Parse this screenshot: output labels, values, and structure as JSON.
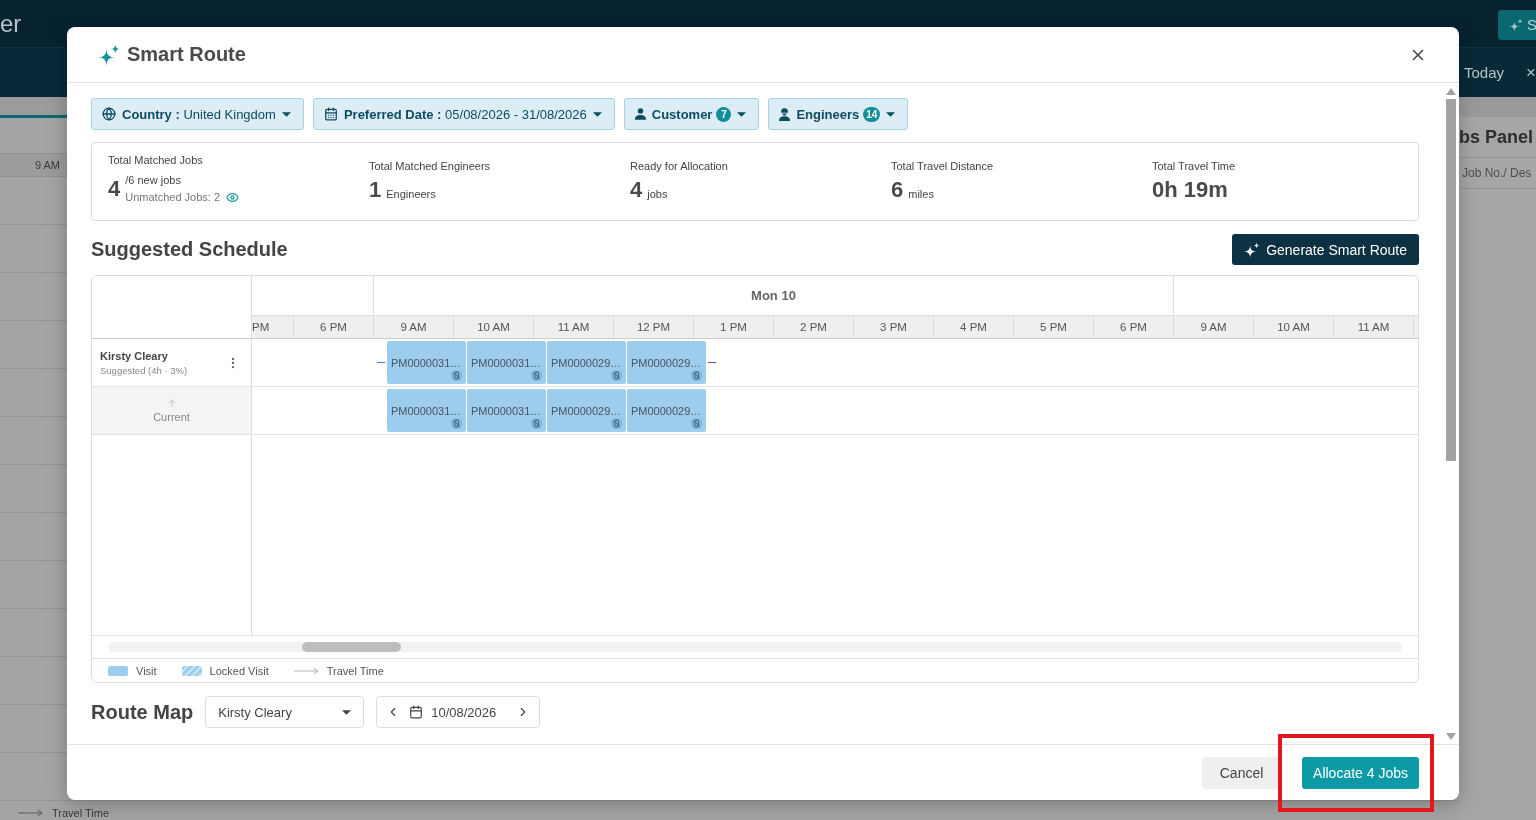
{
  "background": {
    "app_title": "er",
    "top_button": "S",
    "today": "Today",
    "close": "×",
    "hour": "9 AM",
    "panel_title": "bs Panel",
    "search_placeholder": "Job No./ Des",
    "legend": "Travel Time"
  },
  "dialog": {
    "title": "Smart Route"
  },
  "filters": [
    {
      "kind": "country",
      "label": "Country :",
      "value": "United Kingdom"
    },
    {
      "kind": "date",
      "label": "Preferred Date :",
      "value": "05/08/2026 - 31/08/2026"
    },
    {
      "kind": "customer",
      "label": "Customer",
      "count": "7"
    },
    {
      "kind": "engineer",
      "label": "Engineers",
      "count": "14"
    }
  ],
  "stats": [
    {
      "kind": "jobs",
      "label": "Total Matched Jobs",
      "value": "4",
      "detail": "/6 new jobs",
      "note": "Unmatched Jobs: 2"
    },
    {
      "kind": "count",
      "label": "Total Matched Engineers",
      "value": "1",
      "unit": "Engineers"
    },
    {
      "kind": "count",
      "label": "Ready for Allocation",
      "value": "4",
      "unit": "jobs"
    },
    {
      "kind": "count",
      "label": "Total Travel Distance",
      "value": "6",
      "unit": "miles"
    },
    {
      "kind": "time",
      "label": "Total Travel Time",
      "value": "0h 19m"
    }
  ],
  "schedule": {
    "title": "Suggested Schedule",
    "action": "Generate Smart Route",
    "days": [
      {
        "hours": [
          "PM",
          "6 PM"
        ]
      },
      {
        "label": "Mon 10",
        "hours": [
          "9 AM",
          "10 AM",
          "11 AM",
          "12 PM",
          "1 PM",
          "2 PM",
          "3 PM",
          "4 PM",
          "5 PM",
          "6 PM"
        ]
      },
      {
        "hours": [
          "9 AM",
          "10 AM",
          "11 AM"
        ]
      }
    ],
    "rows": [
      {
        "kind": "suggested",
        "name": "Kirsty Cleary",
        "detail": "Suggested (4h · 3%)",
        "jobs": [
          "PM0000031…",
          "PM0000031…",
          "PM0000029…",
          "PM0000029…"
        ]
      },
      {
        "kind": "current",
        "label": "Current",
        "jobs": [
          "PM0000031…",
          "PM0000031…",
          "PM0000029…",
          "PM0000029…"
        ]
      }
    ],
    "legend": [
      {
        "kind": "visit",
        "label": "Visit"
      },
      {
        "kind": "locked",
        "label": "Locked Visit"
      },
      {
        "kind": "travel",
        "label": "Travel Time"
      }
    ]
  },
  "route_map": {
    "title": "Route Map",
    "engineer": "Kirsty Cleary",
    "date": "10/08/2026"
  },
  "footer": {
    "cancel": "Cancel",
    "confirm": "Allocate 4 Jobs",
    "confirm_highlighted": true
  }
}
